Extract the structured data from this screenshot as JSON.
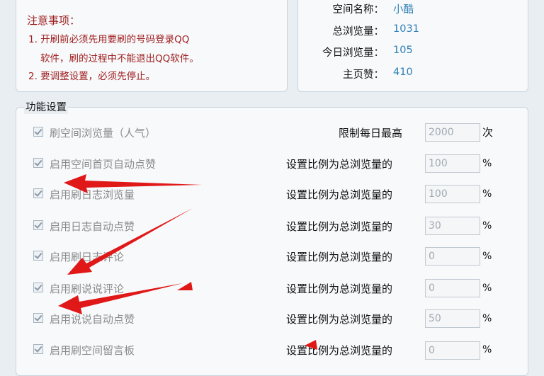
{
  "notice": {
    "title": "注意事项：",
    "line1": "1. 开刷前必须先用要刷的号码登录QQ",
    "line2": "软件，刷的过程中不能退出QQ软件。",
    "line3": "2. 要调整设置，必须先停止。"
  },
  "stats": {
    "space_name_label": "空间名称：",
    "space_name_value": "小酷",
    "total_views_label": "总浏览量：",
    "total_views_value": "1031",
    "today_views_label": "今日浏览量：",
    "today_views_value": "105",
    "homepage_likes_label": "主页赞：",
    "homepage_likes_value": "410"
  },
  "settings": {
    "group_title": "功能设置",
    "rows": [
      {
        "label": "刷空间浏览量（人气）",
        "right_label": "限制每日最高",
        "value": "2000",
        "unit": "次"
      },
      {
        "label": "启用空间首页自动点赞",
        "right_label": "设置比例为总浏览量的",
        "value": "100",
        "unit": "%"
      },
      {
        "label": "启用刷日志浏览量",
        "right_label": "设置比例为总浏览量的",
        "value": "100",
        "unit": "%"
      },
      {
        "label": "启用日志自动点赞",
        "right_label": "设置比例为总浏览量的",
        "value": "30",
        "unit": "%"
      },
      {
        "label": "启用刷日志评论",
        "right_label": "设置比例为总浏览量的",
        "value": "0",
        "unit": "%"
      },
      {
        "label": "启用刷说说评论",
        "right_label": "设置比例为总浏览量的",
        "value": "0",
        "unit": "%"
      },
      {
        "label": "启用说说自动点赞",
        "right_label": "设置比例为总浏览量的",
        "value": "50",
        "unit": "%"
      },
      {
        "label": "启用刷空间留言板",
        "right_label": "设置比例为总浏览量的",
        "value": "0",
        "unit": "%"
      }
    ]
  },
  "colors": {
    "arrow": "#e01818",
    "notice_text": "#a02020",
    "stat_value": "#2e7fb6"
  }
}
